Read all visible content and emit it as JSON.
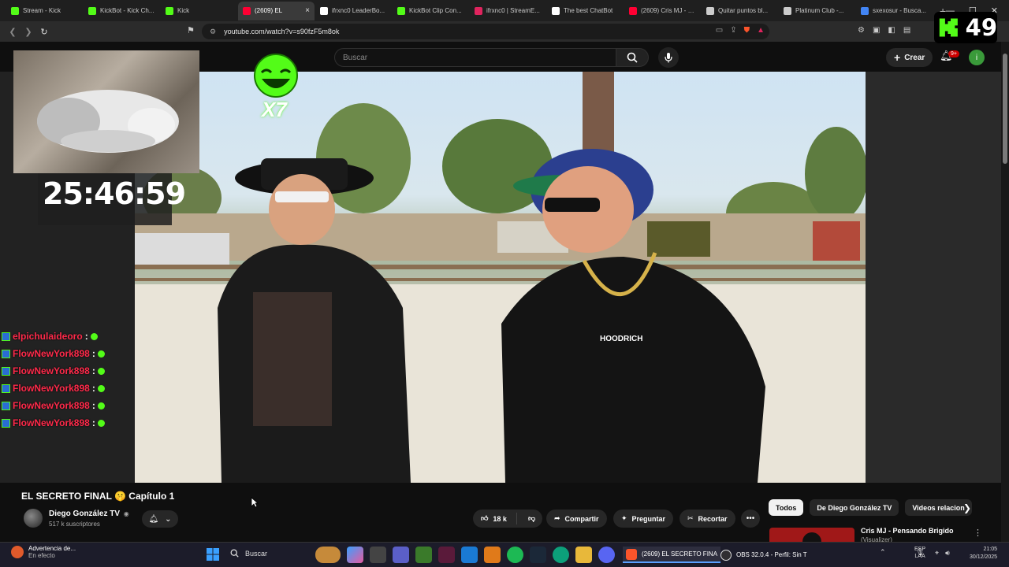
{
  "browser": {
    "tabs": [
      {
        "label": "Stream - Kick",
        "color": "#53fc18",
        "active": false
      },
      {
        "label": "KickBot - Kick Ch...",
        "color": "#53fc18",
        "active": false
      },
      {
        "label": "Kick",
        "color": "#53fc18",
        "active": false
      },
      {
        "label": "(2609) EL",
        "color": "#ff0033",
        "active": true
      },
      {
        "label": "ifrxnc0 LeaderBo...",
        "color": "#ffffff",
        "active": false
      },
      {
        "label": "KickBot Clip Con...",
        "color": "#53fc18",
        "active": false
      },
      {
        "label": "ifrxnc0 | StreamE...",
        "color": "#e0245e",
        "active": false
      },
      {
        "label": "The best ChatBot",
        "color": "#ffffff",
        "active": false
      },
      {
        "label": "(2609) Cris MJ - P...",
        "color": "#ff0033",
        "active": false
      },
      {
        "label": "Quitar puntos bl...",
        "color": "#cccccc",
        "active": false
      },
      {
        "label": "Platinum Club -...",
        "color": "#cccccc",
        "active": false
      },
      {
        "label": "sxexosur - Busca...",
        "color": "#4285f4",
        "active": false
      }
    ],
    "close_glyph": "×",
    "new_tab_glyph": "+",
    "url": "youtube.com/watch?v=s90fzF5m8ok"
  },
  "youtube": {
    "search_placeholder": "Buscar",
    "create_label": "Crear",
    "notif_badge": "9+",
    "avatar_initial": "i"
  },
  "overlay": {
    "timer": "25:46:59",
    "emote_multiplier": "X7",
    "kick_count": "49",
    "chat": [
      {
        "user": "elpichulaideoro",
        "sep": ":"
      },
      {
        "user": "FlowNewYork898",
        "sep": ":"
      },
      {
        "user": "FlowNewYork898",
        "sep": ":"
      },
      {
        "user": "FlowNewYork898",
        "sep": ":"
      },
      {
        "user": "FlowNewYork898",
        "sep": ":"
      },
      {
        "user": "FlowNewYork898",
        "sep": ":"
      }
    ]
  },
  "video": {
    "title": "EL SECRETO FINAL 🤫 Capítulo 1",
    "channel": "Diego González TV",
    "verified_glyph": "◉",
    "subscribers": "517 k suscriptores",
    "likes": "18 k",
    "share_label": "Compartir",
    "ask_label": "Preguntar",
    "clip_label": "Recortar",
    "shirt_text": "HOODRICH"
  },
  "sidebar": {
    "chips": [
      "Todos",
      "De Diego González TV",
      "Videos relacion"
    ],
    "rec_title": "Cris MJ - Pensando Brigido",
    "rec_sub": "(Visualizer)"
  },
  "taskbar": {
    "weather_title": "Advertencia de...",
    "weather_sub": "En efecto",
    "search": "Buscar",
    "youtube_window": "(2609) EL SECRETO FINA",
    "obs_window": "OBS 32.0.4 - Perfil: Sin T",
    "lang_1": "ESP",
    "lang_2": "LAA",
    "time": "21:05",
    "date": "30/12/2025"
  }
}
